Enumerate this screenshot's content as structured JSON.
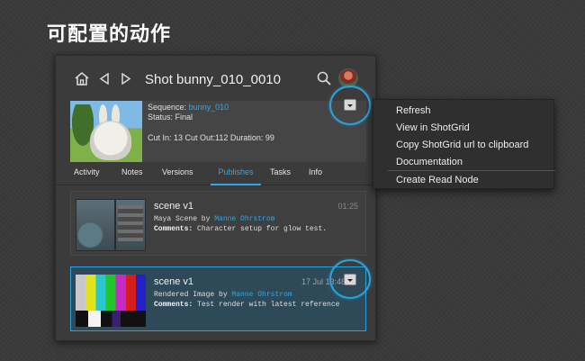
{
  "slide": {
    "title": "可配置的动作"
  },
  "nav": {
    "title": "Shot bunny_010_0010"
  },
  "entity": {
    "sequence_label": "Sequence:",
    "sequence_value": "bunny_010",
    "status_label": "Status:",
    "status_value": "Final",
    "cut_line": "Cut In: 13 Cut Out:112 Duration: 99"
  },
  "tabs": [
    {
      "label": "Activity"
    },
    {
      "label": "Notes"
    },
    {
      "label": "Versions"
    },
    {
      "label": "Publishes"
    },
    {
      "label": "Tasks"
    },
    {
      "label": "Info"
    }
  ],
  "active_tab": "Publishes",
  "publishes": [
    {
      "title": "scene v1",
      "date": "01:25",
      "type_text": "Maya Scene by ",
      "author": "Manne Ohrstrom",
      "comments_label": "Comments:",
      "comments": "Character setup for glow test."
    },
    {
      "title": "scene v1",
      "date": "17 Jul 13:48",
      "type_text": "Rendered Image by ",
      "author": "Manne Ohrstrom",
      "comments_label": "Comments:",
      "comments": "Test render with latest reference"
    }
  ],
  "menu": {
    "items": [
      {
        "label": "Refresh"
      },
      {
        "label": "View in ShotGrid"
      },
      {
        "label": "Copy ShotGrid url to clipboard"
      },
      {
        "label": "Documentation"
      },
      {
        "label": "Create Read Node"
      }
    ]
  },
  "colors": {
    "accent": "#2aa3dd",
    "link": "#2fa8e6",
    "selected_card": "#2e4a58"
  }
}
